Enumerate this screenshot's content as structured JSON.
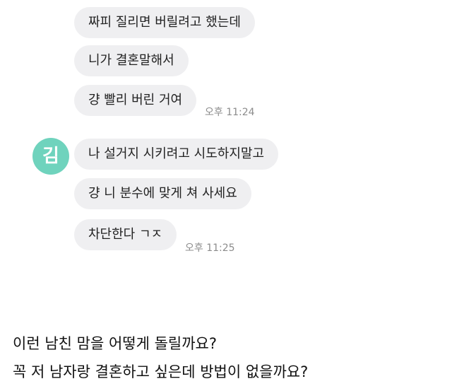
{
  "chat": {
    "first_group": {
      "messages": [
        "짜피 질리면 버릴려고 했는데",
        "니가 결혼말해서",
        "걍 빨리 버린 거여"
      ],
      "time": "오후 11:24"
    },
    "second_group": {
      "sender_avatar_text": "김",
      "messages": [
        "나 설거지 시키려고 시도하지말고",
        "걍 니 분수에 맞게 쳐 사세요",
        "차단한다 ㄱㅈ"
      ],
      "time": "오후 11:25"
    }
  },
  "post_caption": {
    "line1": "이런 남친 맘을 어떻게 돌릴까요?",
    "line2": "꼭 저 남자랑 결혼하고 싶은데 방법이 없을까요?"
  },
  "colors": {
    "bubble_bg": "#efeff1",
    "avatar_bg": "#6fd3bd",
    "time_text": "#8c8c8c"
  }
}
